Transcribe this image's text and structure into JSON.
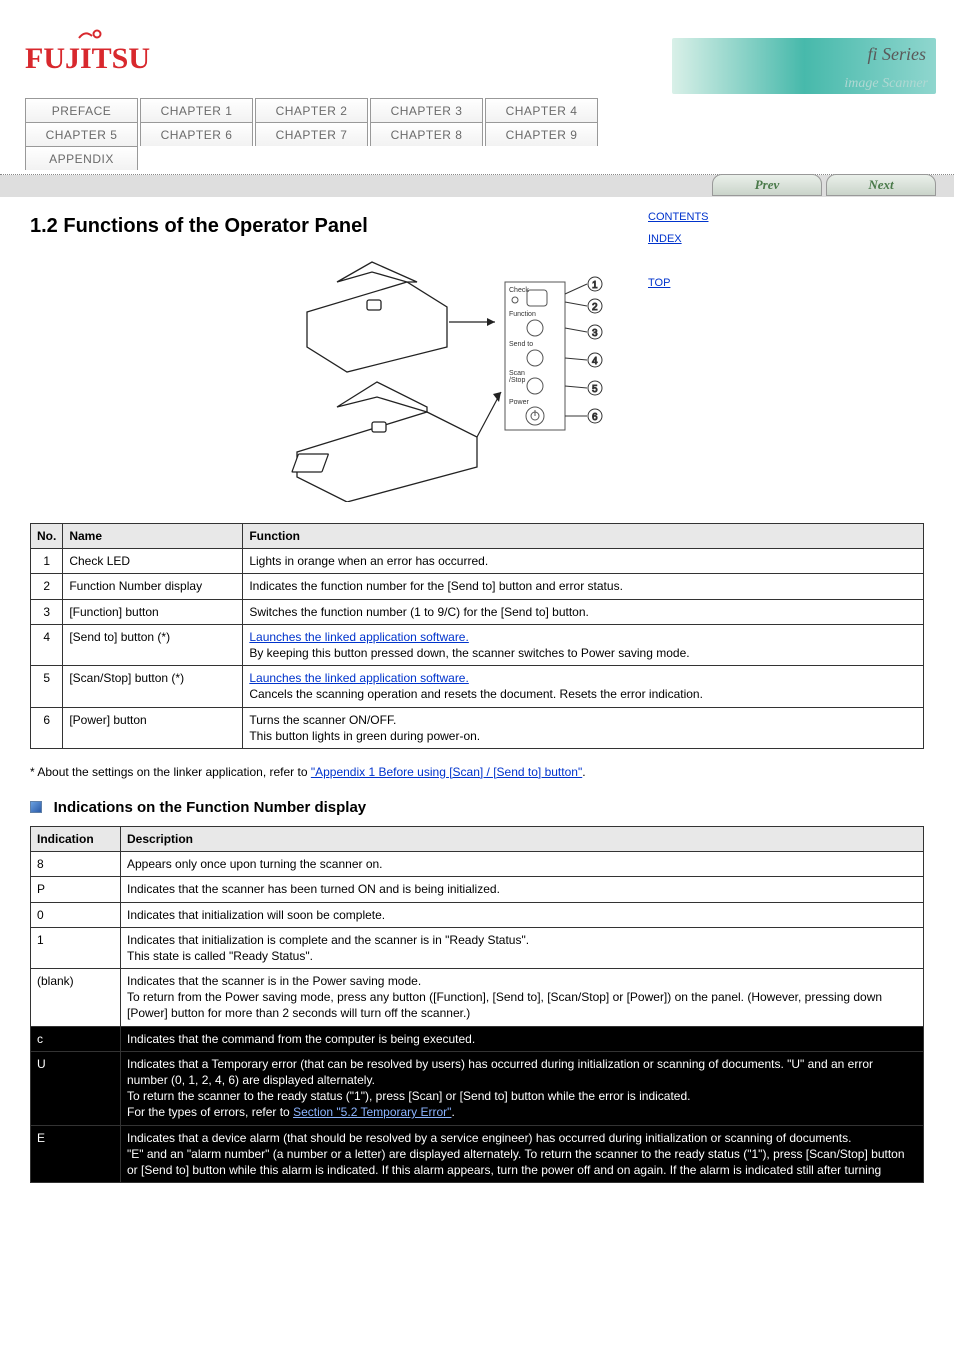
{
  "logo_text": "FUJITSU",
  "banner": {
    "series": "fi Series",
    "sub": "image Scanner"
  },
  "nav_row1": [
    "PREFACE",
    "CHAPTER 1",
    "CHAPTER 2",
    "CHAPTER 3",
    "CHAPTER 4"
  ],
  "nav_row2": [
    "CHAPTER 5",
    "CHAPTER 6",
    "CHAPTER 7",
    "CHAPTER 8",
    "CHAPTER 9"
  ],
  "nav_row3": [
    "APPENDIX"
  ],
  "side": {
    "contents": "CONTENTS",
    "index": "INDEX",
    "top": "TOP"
  },
  "prev": "Prev",
  "next": "Next",
  "section_title": "1.2 Functions of the Operator Panel",
  "panel_labels": [
    "Check",
    "Function",
    "Send to",
    "Scan/Stop",
    "Power"
  ],
  "callouts": [
    "1",
    "2",
    "3",
    "4",
    "5",
    "6"
  ],
  "table1": {
    "headers": [
      "No.",
      "Name",
      "Function"
    ],
    "rows": [
      [
        "1",
        "Check LED",
        "Lights in orange when an error has occurred."
      ],
      [
        "2",
        "Function Number display",
        "Indicates the function number for the [Send to] button and error status."
      ],
      [
        "3",
        "[Function] button",
        "Switches the function number (1 to 9/C) for the [Send to] button."
      ],
      [
        "4",
        "[Send to] button (*)",
        "Launches the linked application software.\nBy keeping this button pressed down, the scanner switches to Power saving mode."
      ],
      [
        "5",
        "[Scan/Stop] button (*)",
        "Launches the linked application software.\nCancels the scanning operation and resets the document. Resets the error indication."
      ],
      [
        "6",
        "[Power] button",
        "Turns the scanner ON/OFF.\nThis button lights in green during power-on."
      ]
    ]
  },
  "ref_line_prefix": "* About the settings on the linker application, refer to ",
  "ref_link": "\"Appendix 1 Before using [Scan] / [Send to] button\"",
  "ref_line_suffix": ".",
  "sub_title": "Indications on the Function Number display",
  "table2": {
    "headers": [
      "Indication",
      "Description"
    ],
    "rows": [
      {
        "ind": "8",
        "desc": "Appears only once upon turning the scanner on.",
        "black": false
      },
      {
        "ind": "P",
        "desc": "Indicates that the scanner has been turned ON and is being initialized.",
        "black": false
      },
      {
        "ind": "0",
        "desc": "Indicates that initialization will soon be complete.",
        "black": false
      },
      {
        "ind": "1",
        "desc": "Indicates that initialization is complete and the scanner is in \"Ready Status\".\nThis state is called \"Ready Status\".",
        "black": false
      },
      {
        "ind": "(blank)",
        "desc": "Indicates that the scanner is in the Power saving mode.\nTo return from the Power saving mode, press any button ([Function], [Send to], [Scan/Stop] or [Power]) on the panel. (However, pressing down [Power] button for more than 2 seconds will turn off the scanner.)",
        "black": false
      },
      {
        "ind": "c",
        "desc": "Indicates that the command from the computer is being executed.",
        "black": true,
        "link": ""
      },
      {
        "ind": "U",
        "desc": "Indicates that a Temporary error (that can be resolved by users) has occurred during initialization or scanning of documents. \"U\" and an error number (0, 1, 2, 4, 6) are displayed alternately.\nTo return the scanner to the ready status (\"1\"), press [Scan] or [Send to] button while the error is indicated.\nFor the types of errors, refer to ",
        "black": true,
        "link": "Section \"5.2 Temporary Error\"",
        "suffix": "."
      },
      {
        "ind": "E",
        "desc": "Indicates that a device alarm (that should be resolved by a service engineer) has occurred during initialization or scanning of documents.\n\"E\" and an \"alarm number\" (a number or a letter) are displayed alternately. To return the scanner to the ready status (\"1\"), press [Scan/Stop] button or [Send to] button while this alarm is indicated. If this alarm appears, turn the power off and on again. If the alarm is indicated still after turning",
        "black": true,
        "link": ""
      }
    ]
  }
}
